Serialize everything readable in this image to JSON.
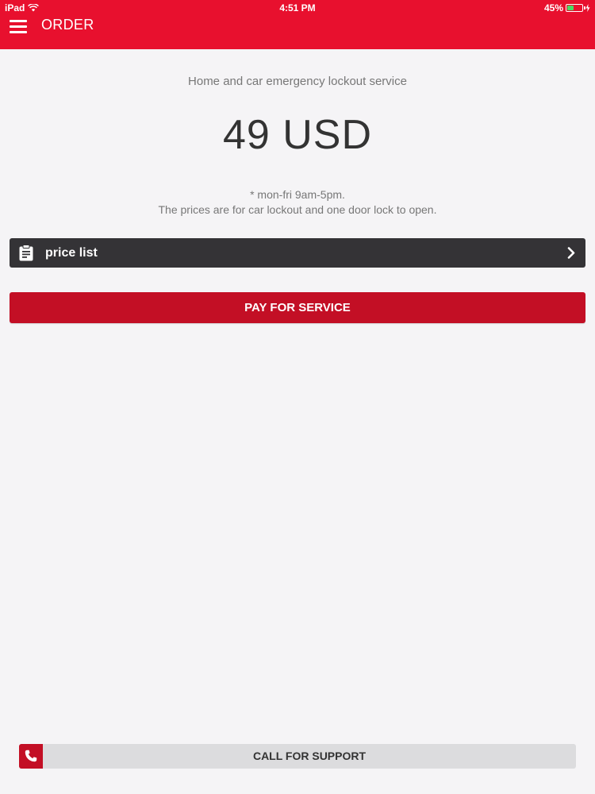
{
  "status_bar": {
    "device": "iPad",
    "time": "4:51 PM",
    "battery_percent": "45%",
    "battery_level": 0.45
  },
  "header": {
    "title": "ORDER",
    "menu_icon": "hamburger-menu-icon"
  },
  "main": {
    "service_title": "Home and car emergency lockout service",
    "price": "49 USD",
    "note_line1": "* mon-fri 9am-5pm.",
    "note_line2": "The prices are for car lockout and one door lock to open."
  },
  "price_list": {
    "label": "price list",
    "icon": "clipboard-icon",
    "chevron": "chevron-right-icon"
  },
  "pay_button": {
    "label": "PAY FOR SERVICE"
  },
  "support": {
    "label": "CALL FOR SUPPORT",
    "icon": "phone-icon"
  },
  "colors": {
    "header_red": "#e8102e",
    "button_red": "#c30f25",
    "dark_bar": "#343336",
    "support_bar": "#dcdcde",
    "background": "#f5f4f6"
  }
}
